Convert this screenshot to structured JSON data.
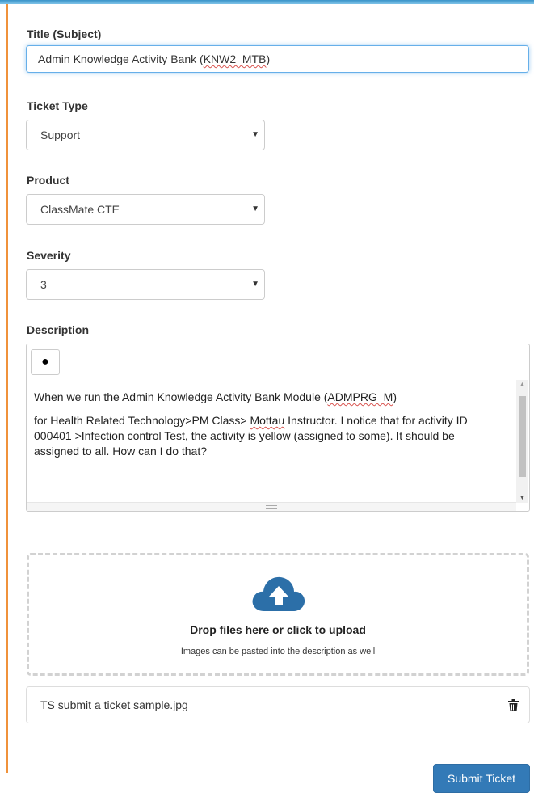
{
  "form": {
    "title_label": "Title (Subject)",
    "title_pre": "Admin Knowledge Activity Bank (",
    "title_spell": "KNW2_MTB",
    "title_post": ")",
    "ticket_type_label": "Ticket Type",
    "ticket_type_value": "Support",
    "product_label": "Product",
    "product_value": "ClassMate CTE",
    "severity_label": "Severity",
    "severity_value": "3",
    "description_label": "Description"
  },
  "editor": {
    "toolbar_bullet": "●",
    "line1_pre": "When we run the Admin Knowledge Activity Bank Module (",
    "line1_spell": "ADMPRG_M",
    "line1_post": ")",
    "line2_pre": "for Health Related Technology>PM Class> ",
    "line2_spell": "Mottau",
    "line2_mid": " Instructor. I notice that for activity ID 000401 >Infection control Test, the activity is yellow (assigned to some). It should be assigned to all. How can I do that?"
  },
  "upload": {
    "title": "Drop files here or click to upload",
    "subtitle": "Images can be pasted into the description as well",
    "icon": "cloud-upload-icon"
  },
  "attachments": [
    {
      "name": "TS submit a ticket sample.jpg",
      "icon": "trash-icon"
    }
  ],
  "submit_label": "Submit Ticket",
  "colors": {
    "accent_border": "#f0923b",
    "primary_button": "#337ab7",
    "upload_icon": "#2c6fa8",
    "focus_border": "#66afe9"
  }
}
